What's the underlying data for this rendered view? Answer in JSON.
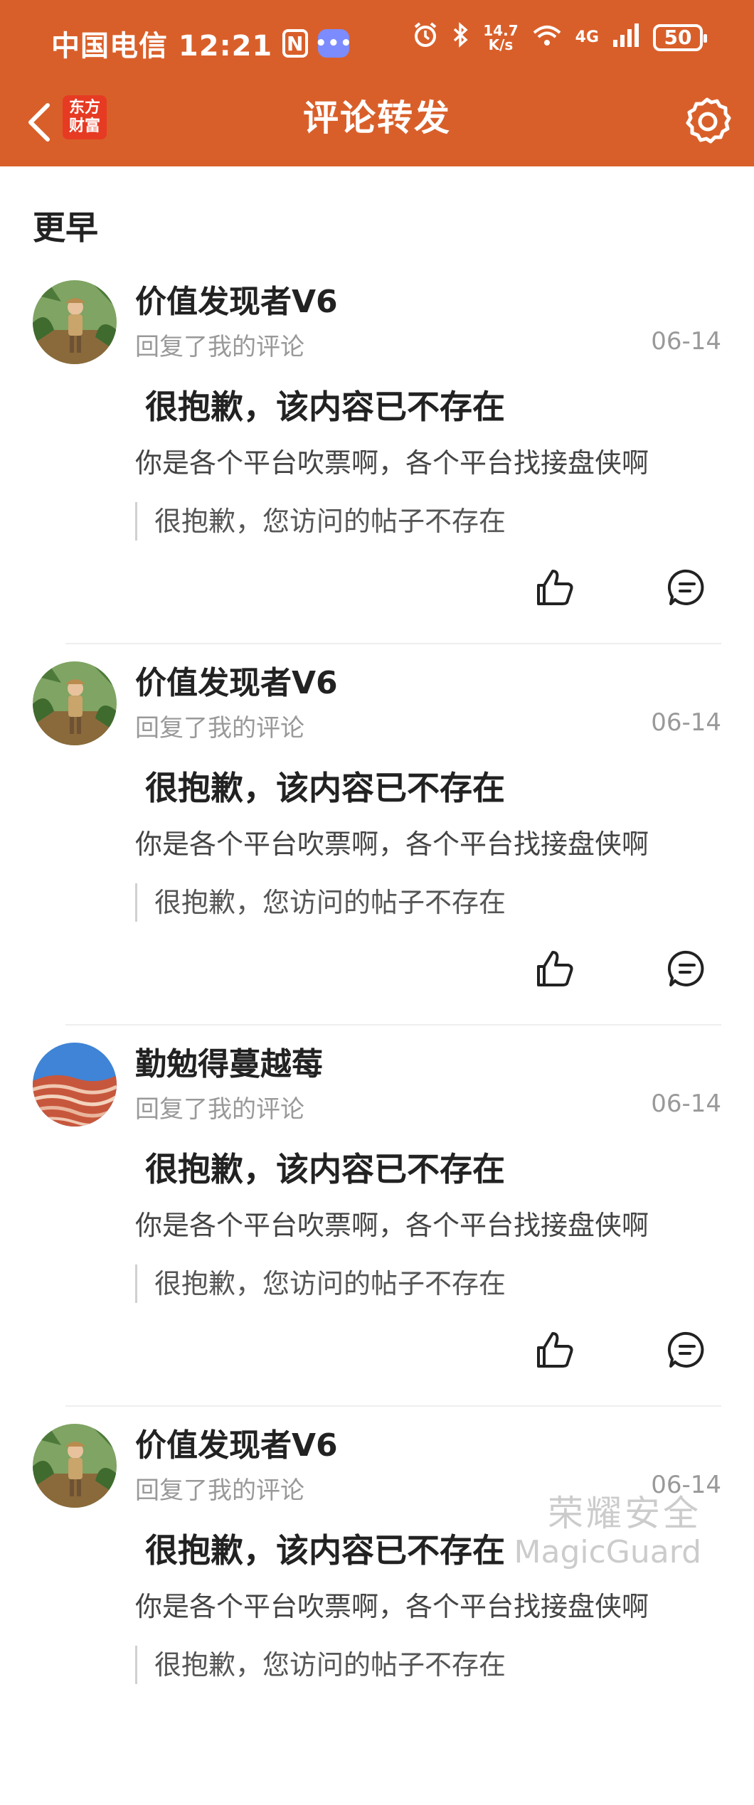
{
  "status_bar": {
    "carrier_time": "中国电信 12:21",
    "nfc_label": "N",
    "speed_value": "14.7",
    "speed_unit": "K/s",
    "network": "4G",
    "battery": "50"
  },
  "header": {
    "title": "评论转发",
    "logo_line1": "东方",
    "logo_line2": "财富",
    "accent_color": "#d95f2a"
  },
  "section_title": "更早",
  "items": [
    {
      "username": "价值发现者V6",
      "action": "回复了我的评论",
      "date": "06-14",
      "title": "很抱歉，该内容已不存在",
      "text": "你是各个平台吹票啊，各个平台找接盘侠啊",
      "quote": "很抱歉，您访问的帖子不存在",
      "avatar": "explorer-jungle-avatar"
    },
    {
      "username": "价值发现者V6",
      "action": "回复了我的评论",
      "date": "06-14",
      "title": "很抱歉，该内容已不存在",
      "text": "你是各个平台吹票啊，各个平台找接盘侠啊",
      "quote": "很抱歉，您访问的帖子不存在",
      "avatar": "explorer-jungle-avatar"
    },
    {
      "username": "勤勉得蔓越莓",
      "action": "回复了我的评论",
      "date": "06-14",
      "title": "很抱歉，该内容已不存在",
      "text": "你是各个平台吹票啊，各个平台找接盘侠啊",
      "quote": "很抱歉，您访问的帖子不存在",
      "avatar": "red-canyon-avatar"
    },
    {
      "username": "价值发现者V6",
      "action": "回复了我的评论",
      "date": "06-14",
      "title": "很抱歉，该内容已不存在",
      "text": "你是各个平台吹票啊，各个平台找接盘侠啊",
      "quote": "很抱歉，您访问的帖子不存在",
      "avatar": "explorer-jungle-avatar"
    }
  ],
  "watermark": {
    "line1": "荣耀安全",
    "line2": "MagicGuard"
  }
}
